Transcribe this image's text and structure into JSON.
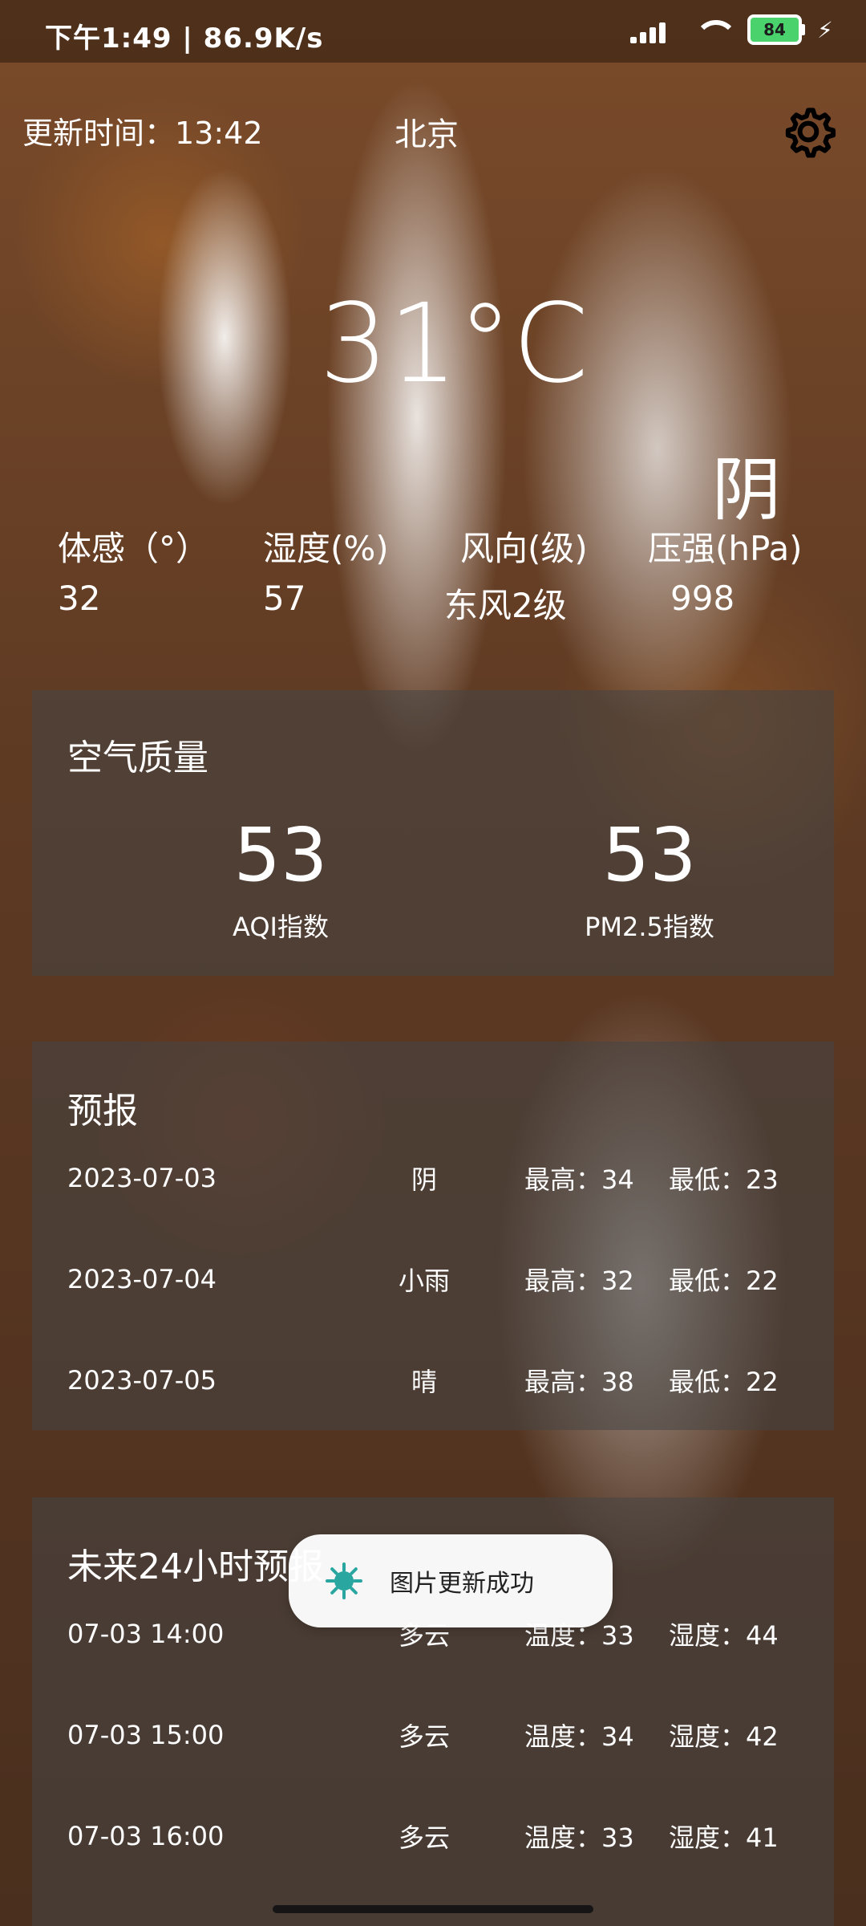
{
  "status_bar": {
    "left_text": "下午1:49 | 86.9K/s",
    "battery_level": "84"
  },
  "header": {
    "update_time": "更新时间：13:42",
    "city": "北京"
  },
  "current": {
    "temperature": "31°C",
    "condition": "阴"
  },
  "metrics": [
    {
      "label": "体感（°）",
      "value": "32"
    },
    {
      "label": "湿度(%)",
      "value": "57"
    },
    {
      "label": "风向(级)",
      "value": "东风2级"
    },
    {
      "label": "压强(hPa)",
      "value": "998"
    }
  ],
  "air_quality": {
    "title": "空气质量",
    "aqi_value": "53",
    "aqi_label": "AQI指数",
    "pm25_value": "53",
    "pm25_label": "PM2.5指数"
  },
  "forecast": {
    "title": "预报",
    "rows": [
      {
        "date": "2023-07-03",
        "cond": "阴",
        "high": "最高：34",
        "low": "最低：23"
      },
      {
        "date": "2023-07-04",
        "cond": "小雨",
        "high": "最高：32",
        "low": "最低：22"
      },
      {
        "date": "2023-07-05",
        "cond": "晴",
        "high": "最高：38",
        "low": "最低：22"
      }
    ]
  },
  "hourly": {
    "title": "未来24小时预报",
    "rows": [
      {
        "time": "07-03 14:00",
        "cond": "多云",
        "temp": "温度：33",
        "hum": "湿度：44"
      },
      {
        "time": "07-03 15:00",
        "cond": "多云",
        "temp": "温度：34",
        "hum": "湿度：42"
      },
      {
        "time": "07-03 16:00",
        "cond": "多云",
        "temp": "温度：33",
        "hum": "湿度：41"
      }
    ]
  },
  "toast": {
    "text": "图片更新成功",
    "icon": "sun-icon"
  }
}
